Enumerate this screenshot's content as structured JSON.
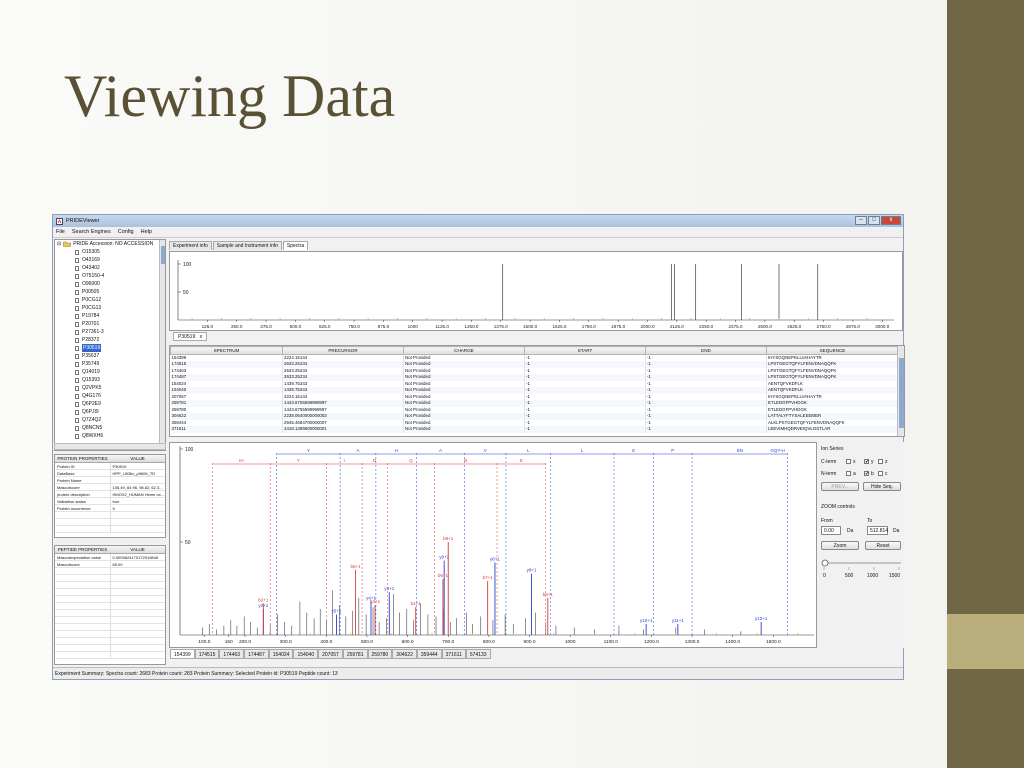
{
  "slide": {
    "title": "Viewing Data"
  },
  "window": {
    "title": "PRIDEViewer",
    "min": "–",
    "max": "□",
    "close": "x"
  },
  "menu": [
    "File",
    "Search Engines",
    "Config",
    "Help"
  ],
  "tree": {
    "root": "PRIDE Accession: NO ACCESSION",
    "items": [
      "O15305",
      "O43169",
      "O43402",
      "O75150-4",
      "O96000",
      "P00505",
      "P0CG12",
      "P0CG13",
      "P19784",
      "P20701",
      "P27361-3",
      "P28372",
      "P30519",
      "P35637",
      "P35749",
      "Q14019",
      "Q15393",
      "Q2VPK5",
      "Q4G176",
      "Q6P2E9",
      "Q6PJI9",
      "Q7Z4Q2",
      "Q8NCN5",
      "Q8WXH6"
    ],
    "selected": "P30519"
  },
  "protein_props": {
    "header": [
      "PROTEIN PROPERTIES",
      "VALUE"
    ],
    "rows": [
      [
        "Protein ID",
        "P30519"
      ],
      [
        "DataBase",
        "HPP_UKBio_p9606_TD"
      ],
      [
        "Protein Name",
        ""
      ],
      [
        "Mascotscore",
        "106.49, 64.96, 98.62, 62.3..."
      ],
      [
        "protein description",
        "HMOX2_HUMAN Heme ox..."
      ],
      [
        "Validation status",
        "true"
      ],
      [
        "Protein occurrence",
        "9"
      ]
    ]
  },
  "peptide_props": {
    "header": [
      "PEPTIDE PROPERTIES",
      "VALUE"
    ],
    "rows": [
      [
        "Mascotexpectation value",
        "0.0005824170172919848"
      ],
      [
        "Mascotscore",
        "65.00"
      ]
    ]
  },
  "tabs": [
    "Experiment info",
    "Sample and Instrument info",
    "Spectra"
  ],
  "active_tab": "Spectra",
  "subtab": {
    "label": "P30519",
    "close": "x"
  },
  "top_chart": {
    "y_ticks": [
      "100",
      "50"
    ],
    "x_ticks": [
      "125.0",
      "250.0",
      "375.0",
      "500.0",
      "625.0",
      "750.0",
      "875.0",
      "1000",
      "1125.0",
      "1250.0",
      "1375.0",
      "1500.0",
      "1625.0",
      "1750.0",
      "1875.0",
      "2000.0",
      "2125.0",
      "2250.0",
      "2375.0",
      "2500.0",
      "2625.0",
      "2750.0",
      "2875.0",
      "3000.0"
    ],
    "peaks_x": [
      1383,
      2102,
      2115,
      2205,
      2400,
      2560,
      2725
    ]
  },
  "table": {
    "columns": [
      "SPECTRUM",
      "PRECURSOR",
      "CHARGE",
      "START",
      "END",
      "SEQUENCE"
    ],
    "rows": [
      [
        "154399",
        "2224.15144",
        "Not Provided",
        "-1",
        "-1",
        "IHYSGQNEPELLVAHAYTR"
      ],
      [
        "174515",
        "2633.25234",
        "Not Provided",
        "-1",
        "-1",
        "LPSTGEGTQFYLFENVDNAQQFK"
      ],
      [
        "174463",
        "2633.25234",
        "Not Provided",
        "-1",
        "-1",
        "LPSTGEGTQFYLFENVDNAQQFK"
      ],
      [
        "174487",
        "2633.25234",
        "Not Provided",
        "-1",
        "-1",
        "LPSTGEGTQFYLFENVDNAQQFK"
      ],
      [
        "154024",
        "1439.75343",
        "Not Provided",
        "-1",
        "-1",
        "AENTQFVKDFLK"
      ],
      [
        "154040",
        "1439.75343",
        "Not Provided",
        "-1",
        "-1",
        "AENTQFVKDFLK"
      ],
      [
        "207057",
        "2224.15144",
        "Not Provided",
        "-1",
        "-1",
        "IHYSGQNEPELLVAHAYTR"
      ],
      [
        "259781",
        "1443.6755599999997",
        "Not Provided",
        "-1",
        "-1",
        "ETLEDGFPVHDGK"
      ],
      [
        "259780",
        "1443.6755599999997",
        "Not Provided",
        "-1",
        "-1",
        "ETLEDGFPVHDGK"
      ],
      [
        "304622",
        "2238.0640000000003",
        "Not Provided",
        "-1",
        "-1",
        "LATTALYFTYSALEEEMER"
      ],
      [
        "359444",
        "2945.4684700000007",
        "Not Provided",
        "-1",
        "-1",
        "ALKLPSTGEGTQFYLFENVDNAQQFK"
      ],
      [
        "371611",
        "3418.1399600000001",
        "Not Provided",
        "-1",
        "-1",
        "LEEVIMHQDRVEIQVLGSTLAR"
      ]
    ]
  },
  "spectrum": {
    "y_ticks": [
      "100",
      "50"
    ],
    "x_ticks": [
      "100.0",
      "200.0",
      "300.0",
      "400.0",
      "500.0",
      "600.0",
      "700.0",
      "800.0",
      "900.0",
      "1000",
      "1100.0",
      "1200.0",
      "1300.0",
      "1400.0",
      "1500.0",
      "160"
    ],
    "blue_top_labels": [
      "Y",
      "A",
      "H",
      "A",
      "V",
      "L",
      "L",
      "E",
      "P",
      "EN",
      "GQY-H"
    ],
    "red_top_labels": [
      "IH",
      "Y",
      "I",
      "D",
      "Q",
      "N",
      "E"
    ],
    "blue_ions": [
      "y9+1",
      "y6+1",
      "y8+1",
      "y3+1",
      "y4+1",
      "y2+1",
      "y5+1",
      "y10+1",
      "y11+1",
      "y12+1"
    ],
    "red_ions": [
      "b5+1",
      "b6+1",
      "b7+1",
      "b8+1",
      "b2+1",
      "b3+1",
      "b4+1",
      "b9+1"
    ]
  },
  "ion_panel": {
    "title": "Ion Series",
    "cterm": "C-term",
    "nterm": "N-term",
    "cterm_opts": [
      "x",
      "y",
      "z"
    ],
    "nterm_opts": [
      "a",
      "b",
      "c"
    ],
    "check": "✔",
    "prev_btn": "PREV...",
    "hide_btn": "Hide Seq.",
    "zoom_title": "ZOOM controls",
    "from_label": "From",
    "to_label": "To",
    "from_val": "0.00",
    "to_val": "512.814",
    "unit": "Da",
    "zoom_btn": "Zoom",
    "reset_btn": "Reset",
    "slider_ticks": [
      "0",
      "500",
      "1000",
      "1500"
    ]
  },
  "bottom_tabs": [
    "154399",
    "174515",
    "174463",
    "174487",
    "154024",
    "154040",
    "207057",
    "259781",
    "259780",
    "304622",
    "359444",
    "371611",
    "574133"
  ],
  "status": "Experiment Summary: Spectra count: 2683  Protein count: 283  Protein Summary: Selected Protein id: P30519  Peptide count: 13"
}
